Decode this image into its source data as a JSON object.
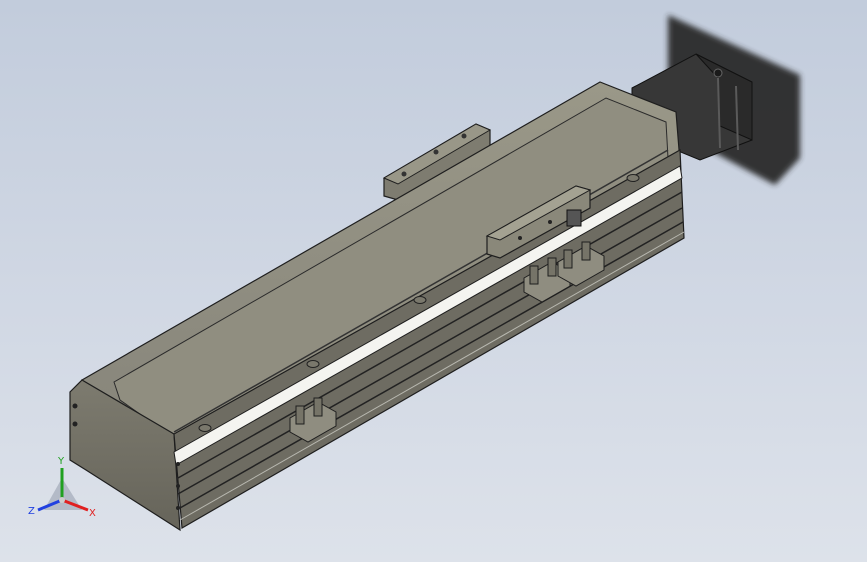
{
  "viewport": {
    "background_top": "#c2ccdc",
    "background_bottom": "#dde2ea"
  },
  "model": {
    "body_color": "#8c8a7c",
    "body_shadow_color": "#5f5d52",
    "rail_color": "#f4f4f0",
    "edge_color": "#1e1e1e",
    "motor_color": "#2b2b2b"
  },
  "triad": {
    "x_label": "X",
    "y_label": "Y",
    "z_label": "Z",
    "x_color": "#e02020",
    "y_color": "#20a020",
    "z_color": "#2040e0"
  }
}
